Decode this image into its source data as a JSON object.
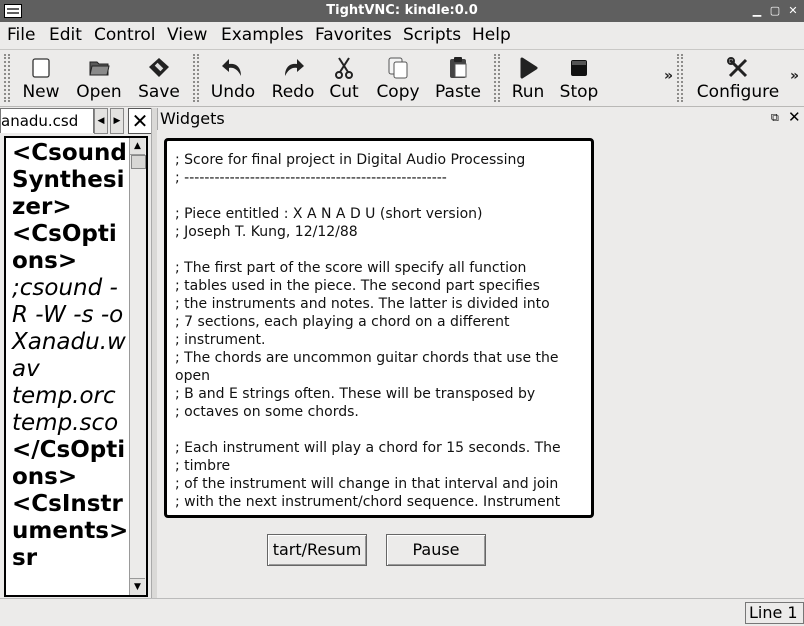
{
  "window": {
    "title": "TightVNC: kindle:0.0"
  },
  "menubar": [
    "File",
    "Edit",
    "Control",
    "View",
    "Examples",
    "Favorites",
    "Scripts",
    "Help"
  ],
  "toolbar": {
    "new": "New",
    "open": "Open",
    "save": "Save",
    "undo": "Undo",
    "redo": "Redo",
    "cut": "Cut",
    "copy": "Copy",
    "paste": "Paste",
    "run": "Run",
    "stop": "Stop",
    "configure": "Configure",
    "overflow": "»"
  },
  "editor": {
    "tab_label": "anadu.csd",
    "lines": [
      {
        "text": "<CsoundSynthesizer>",
        "style": "b"
      },
      {
        "text": "<CsOptions>",
        "style": "b"
      },
      {
        "text": ";csound -R -W -s -o Xanadu.wav",
        "style": "i"
      },
      {
        "text": "temp.orc",
        "style": "i"
      },
      {
        "text": "temp.sco",
        "style": "i"
      },
      {
        "text": "</CsOptions>",
        "style": "b"
      },
      {
        "text": "<CsInstruments>",
        "style": "b"
      },
      {
        "text": "sr",
        "style": "b"
      }
    ]
  },
  "widgets": {
    "title": "Widgets",
    "score_text": "; Score for final project in Digital Audio Processing\n; ----------------------------------------------------\n\n; Piece entitled : X A N A D U (short version)\n; Joseph T. Kung, 12/12/88\n\n; The first part of the score will specify all function\n; tables used in the piece. The second part specifies\n; the instruments and notes. The latter is divided into\n; 7 sections, each playing a chord on a different\n; instrument.\n; The chords are uncommon guitar chords that use the\nopen\n; B and E strings often. These will be transposed by\n; octaves on some chords.\n\n; Each instrument will play a chord for 15 seconds. The\n; timbre\n; of the instrument will change in that interval and join\n; with the next instrument/chord sequence. Instrument",
    "start_button": "tart/Resum",
    "pause_button": "Pause"
  },
  "status": {
    "line": "Line 1"
  }
}
